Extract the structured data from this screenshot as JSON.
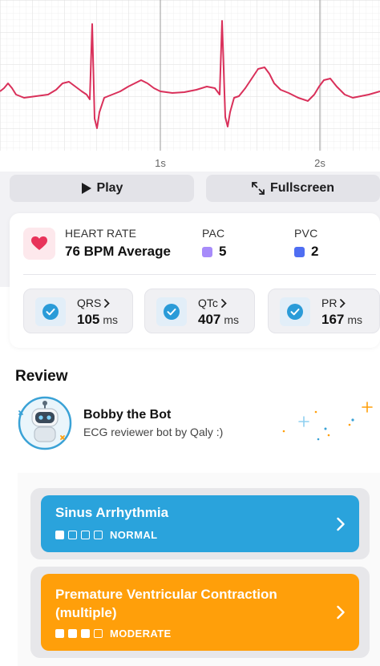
{
  "ecg": {
    "tick_labels": [
      "1s",
      "2s"
    ],
    "trace_color": "#d9305a"
  },
  "toolbar": {
    "play_label": "Play",
    "fullscreen_label": "Fullscreen"
  },
  "stats": {
    "heart_rate": {
      "label": "HEART RATE",
      "value": "76 BPM Average"
    },
    "pac": {
      "label": "PAC",
      "value": "5",
      "color": "#a78bfa"
    },
    "pvc": {
      "label": "PVC",
      "value": "2",
      "color": "#4f6ef2"
    }
  },
  "metrics": [
    {
      "label": "QRS",
      "value": "105",
      "unit": "ms"
    },
    {
      "label": "QTc",
      "value": "407",
      "unit": "ms"
    },
    {
      "label": "PR",
      "value": "167",
      "unit": "ms"
    }
  ],
  "review": {
    "title": "Review",
    "reviewer_name": "Bobby the Bot",
    "reviewer_subtitle": "ECG reviewer bot by Qaly :)"
  },
  "findings": [
    {
      "title_line1": "Sinus Arrhythmia",
      "title_line2": "",
      "severity": "NORMAL",
      "severity_level": 1,
      "color": "#2aa3dc"
    },
    {
      "title_line1": "Premature Ventricular Contraction",
      "title_line2": "(multiple)",
      "severity": "MODERATE",
      "severity_level": 3,
      "color": "#ff9f0a"
    }
  ]
}
